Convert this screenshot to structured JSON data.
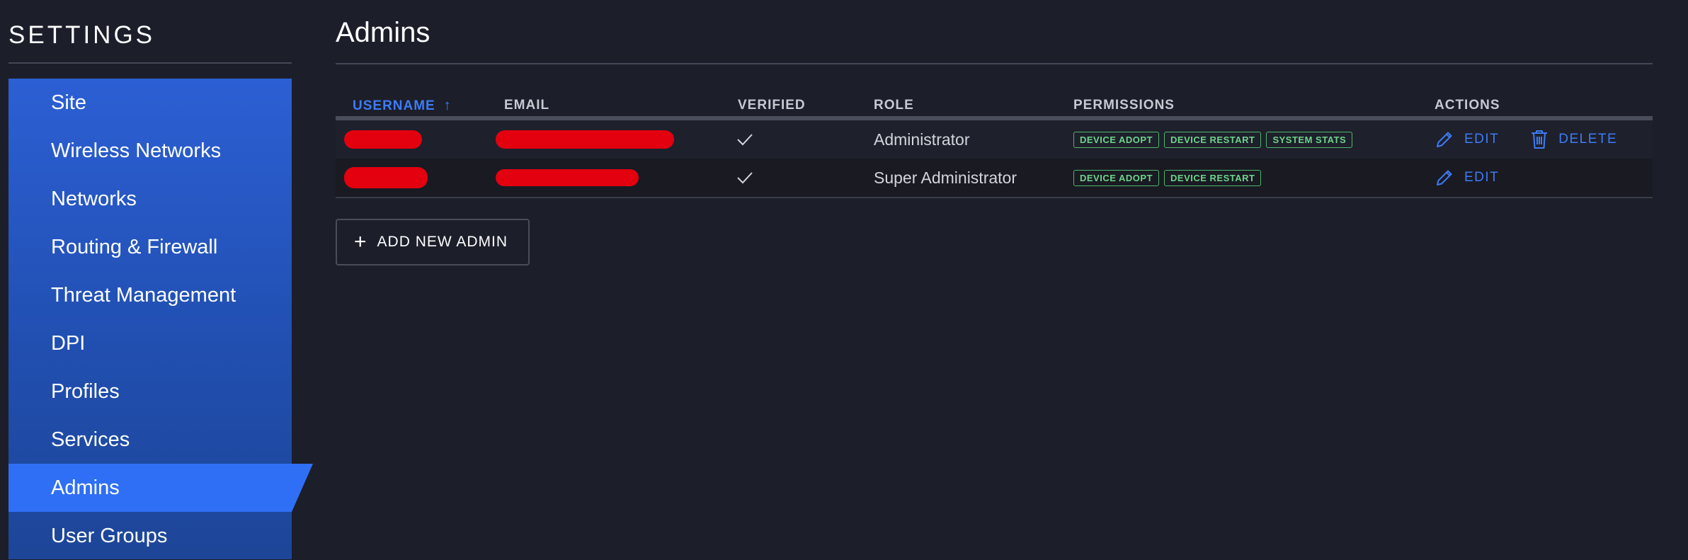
{
  "sidebar": {
    "title": "SETTINGS",
    "items": [
      {
        "label": "Site"
      },
      {
        "label": "Wireless Networks"
      },
      {
        "label": "Networks"
      },
      {
        "label": "Routing & Firewall"
      },
      {
        "label": "Threat Management"
      },
      {
        "label": "DPI"
      },
      {
        "label": "Profiles"
      },
      {
        "label": "Services"
      },
      {
        "label": "Admins"
      },
      {
        "label": "User Groups"
      }
    ],
    "active": "Admins",
    "accent": "#2f6ff5"
  },
  "main": {
    "title": "Admins",
    "table": {
      "columns": {
        "username": "USERNAME",
        "email": "EMAIL",
        "verified": "VERIFIED",
        "role": "ROLE",
        "permissions": "PERMISSIONS",
        "actions": "ACTIONS"
      },
      "sort": {
        "column": "USERNAME",
        "direction": "ascending",
        "icon": "arrow-up-icon"
      },
      "rows": [
        {
          "verified_icon": "checkmark-icon",
          "role": "Administrator",
          "permissions": [
            "DEVICE ADOPT",
            "DEVICE RESTART",
            "SYSTEM STATS"
          ],
          "edit_label": "EDIT",
          "delete_label": "DELETE"
        },
        {
          "verified_icon": "checkmark-icon",
          "role": "Super Administrator",
          "permissions": [
            "DEVICE ADOPT",
            "DEVICE RESTART"
          ],
          "edit_label": "EDIT"
        }
      ]
    },
    "add_button": {
      "label": "ADD NEW ADMIN",
      "icon": "plus-icon"
    }
  },
  "colors": {
    "background": "#1c1e2a",
    "link": "#3d7cf6",
    "badge": "#4eb86b",
    "redaction": "#e3000f"
  }
}
